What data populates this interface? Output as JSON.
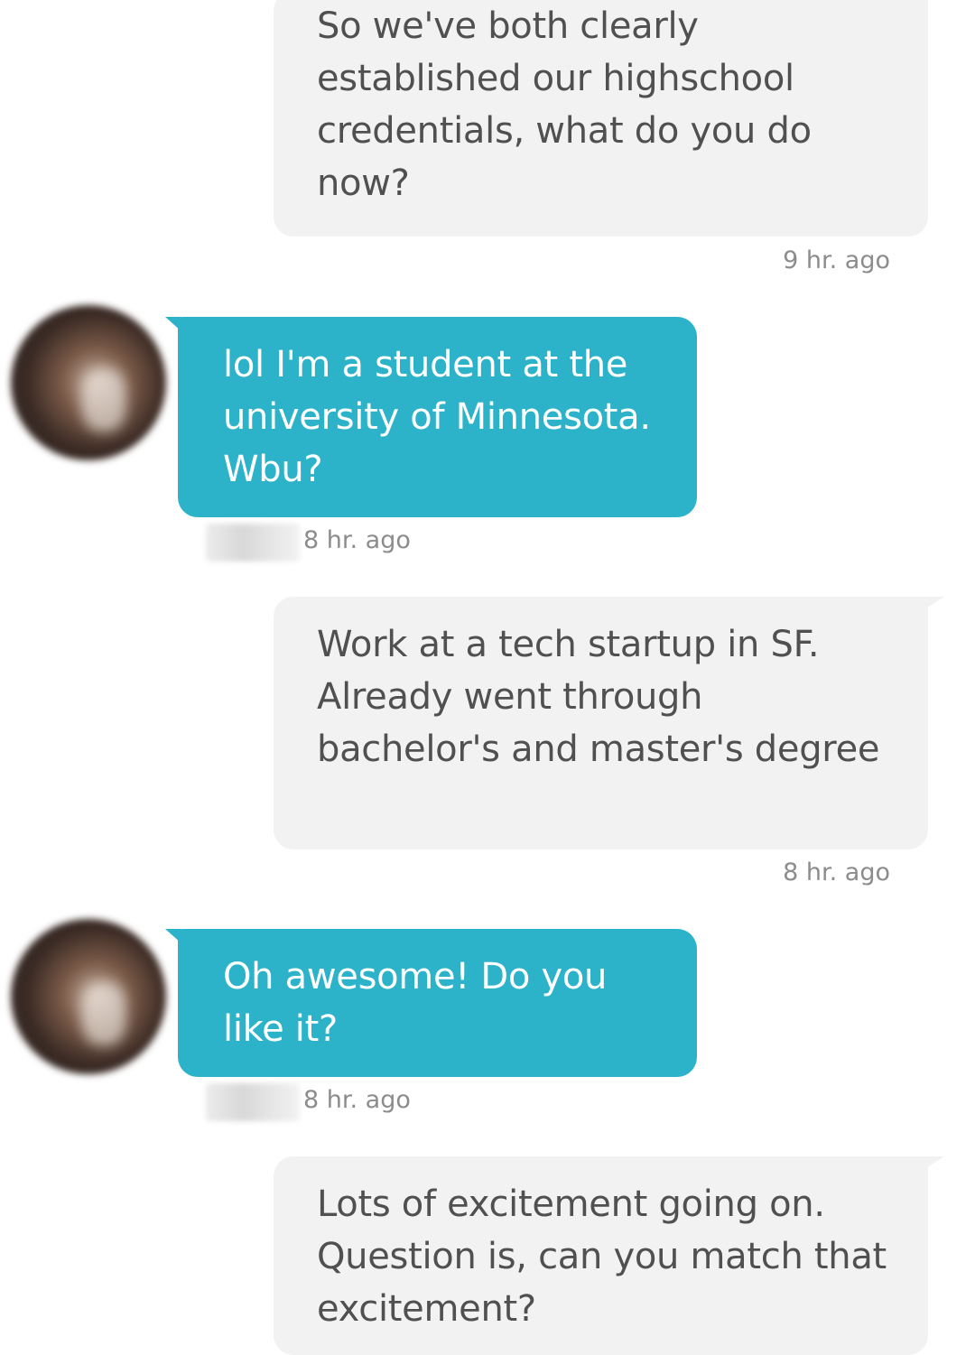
{
  "conversation": {
    "messages": [
      {
        "sender": "me",
        "text": "So we've both clearly established our highschool credentials, what do you do now?",
        "time": "9 hr. ago"
      },
      {
        "sender": "match",
        "text": "lol I'm a student at the university of Minnesota. Wbu?",
        "time": "8 hr. ago"
      },
      {
        "sender": "me",
        "text": "Work at a tech startup in SF. Already went through bachelor's and master's degree",
        "time": "8 hr. ago"
      },
      {
        "sender": "match",
        "text": "Oh awesome! Do you like it?",
        "time": "8 hr. ago"
      },
      {
        "sender": "me",
        "text": "Lots of excitement going on. Question is, can you match that excitement?",
        "time": ""
      }
    ]
  },
  "colors": {
    "sent_bubble": "#f2f2f2",
    "sent_text": "#505050",
    "received_bubble": "#2cb2c9",
    "received_text": "#ffffff",
    "timestamp": "#8c8c8c"
  }
}
